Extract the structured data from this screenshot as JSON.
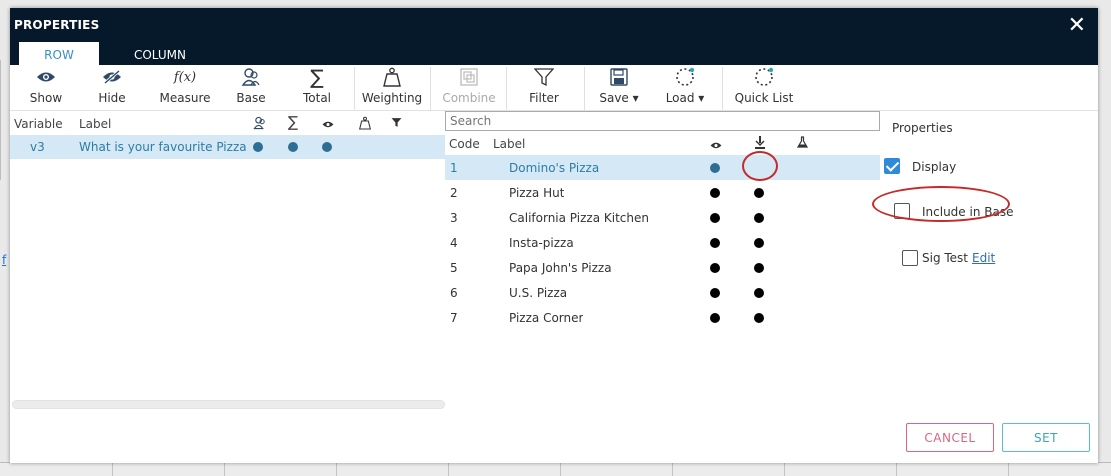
{
  "dialog": {
    "title": "PROPERTIES",
    "close_glyph": "✕",
    "tabs": [
      {
        "label": "ROW",
        "active": true
      },
      {
        "label": "COLUMN",
        "active": false
      }
    ]
  },
  "background": {
    "link_fragment": "f"
  },
  "toolbar": {
    "items": [
      {
        "label": "Show",
        "icon": "eye-icon"
      },
      {
        "label": "Hide",
        "icon": "eye-slash-icon"
      },
      {
        "label": "Measure",
        "icon": "function-icon",
        "icon_text": "f(x)"
      },
      {
        "label": "Base",
        "icon": "people-icon"
      },
      {
        "label": "Total",
        "icon": "sigma-icon",
        "icon_text": "∑"
      },
      {
        "label": "Weighting",
        "icon": "weight-icon"
      },
      {
        "label": "Combine",
        "icon": "combine-icon",
        "disabled": true
      },
      {
        "label": "Filter",
        "icon": "funnel-icon"
      },
      {
        "label": "Save ▾",
        "icon": "floppy-icon"
      },
      {
        "label": "Load ▾",
        "icon": "load-icon"
      },
      {
        "label": "Quick List",
        "icon": "quicklist-icon"
      }
    ]
  },
  "variables": {
    "headers": {
      "variable": "Variable",
      "label": "Label",
      "sigma": "∑"
    },
    "rows": [
      {
        "variable": "v3",
        "label": "What is your favourite Pizza c"
      }
    ]
  },
  "codes": {
    "search_placeholder": "Search",
    "headers": {
      "code": "Code",
      "label": "Label"
    },
    "rows": [
      {
        "code": "1",
        "label": "Domino's Pizza",
        "selected": true
      },
      {
        "code": "2",
        "label": "Pizza Hut"
      },
      {
        "code": "3",
        "label": "California Pizza Kitchen"
      },
      {
        "code": "4",
        "label": "Insta-pizza"
      },
      {
        "code": "5",
        "label": "Papa John's Pizza"
      },
      {
        "code": "6",
        "label": "U.S. Pizza"
      },
      {
        "code": "7",
        "label": "Pizza Corner"
      }
    ]
  },
  "properties": {
    "title": "Properties",
    "display_label": "Display",
    "include_in_base_label": "Include in Base",
    "sig_test_label": "Sig Test",
    "edit_link": "Edit",
    "display_checked": true,
    "include_in_base_checked": false,
    "sig_test_checked": false
  },
  "buttons": {
    "cancel": "CANCEL",
    "set": "SET"
  },
  "colors": {
    "titlebar": "#05192a",
    "selection": "#d4e9f5",
    "accent_blue": "#2f7ca6",
    "cancel": "#d9677f",
    "set": "#58c1c6",
    "annotation": "#c52a2a"
  }
}
